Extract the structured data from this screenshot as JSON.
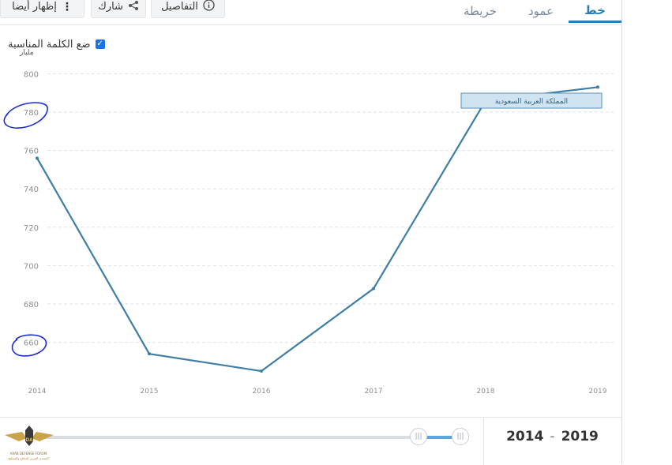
{
  "tabs": [
    {
      "label": "خط",
      "active": true
    },
    {
      "label": "عمود",
      "active": false
    },
    {
      "label": "خريطة",
      "active": false
    }
  ],
  "toolbar": {
    "details_label": "التفاصيل",
    "share_label": "شارك",
    "more_label": "إظهار أيضا"
  },
  "legend": {
    "checkbox_label": "ضع الكلمة المناسبة",
    "checked": true
  },
  "unit_label": "مليار",
  "series_label": "المملكة العربية السعودية",
  "range": {
    "start": "2014",
    "end": "2019",
    "separator": "-"
  },
  "logo": {
    "line1": "ARAB DEFENSE FORUM",
    "line2": "المنتدى العربي للدفاع والتسليح"
  },
  "colors": {
    "line": "#3d7ea6",
    "accent": "#2a7fb5",
    "annotation_circle": "#1a2bd8"
  },
  "chart_data": {
    "type": "line",
    "title": "",
    "xlabel": "",
    "ylabel": "مليار",
    "x": [
      "2014",
      "2015",
      "2016",
      "2017",
      "2018",
      "2019"
    ],
    "series": [
      {
        "name": "المملكة العربية السعودية",
        "values": [
          756,
          654,
          645,
          688,
          786,
          793
        ]
      }
    ],
    "ylim": [
      640,
      800
    ],
    "yticks": [
      660,
      680,
      700,
      720,
      740,
      760,
      780,
      800
    ],
    "grid": true,
    "legend_position": "top-left"
  }
}
